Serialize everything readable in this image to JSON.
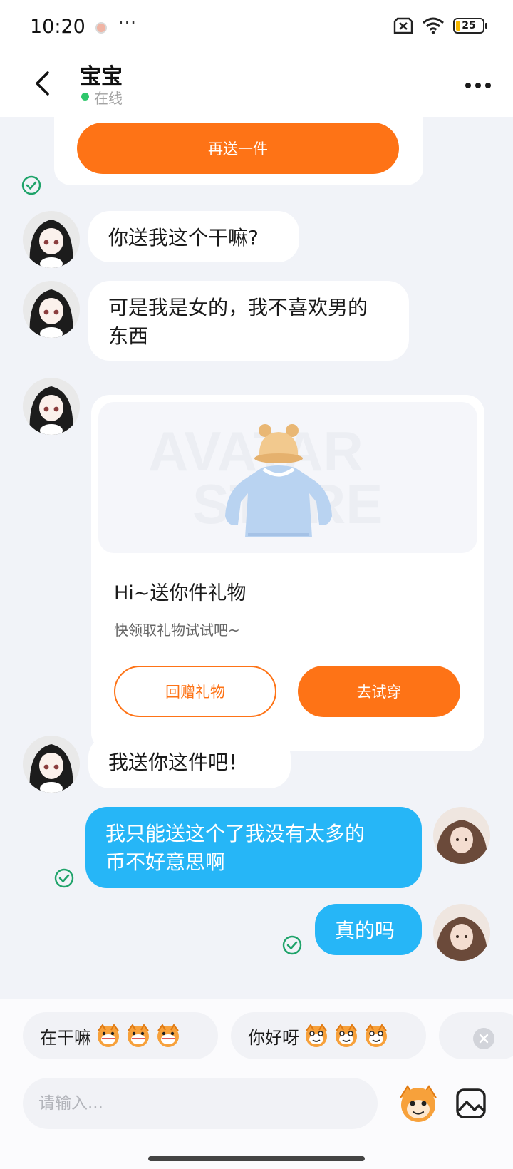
{
  "status_bar": {
    "time": "10:20",
    "more": "···",
    "battery": "25"
  },
  "header": {
    "contact_name": "宝宝",
    "online_status": "在线"
  },
  "top_card": {
    "resend_label": "再送一件"
  },
  "messages": [
    {
      "sender": "them",
      "text": "你送我这个干嘛?"
    },
    {
      "sender": "them",
      "text_line1": "可是我是女的，我不喜欢男的",
      "text_line2": "东西"
    },
    {
      "sender": "them",
      "type": "gift"
    },
    {
      "sender": "them",
      "text": "我送你这件吧！"
    },
    {
      "sender": "me",
      "text_line1": "我只能送这个了我没有太多的",
      "text_line2": "币不好意思啊"
    },
    {
      "sender": "me",
      "text": "真的吗"
    }
  ],
  "gift_card": {
    "title": "Hi~送你件礼物",
    "subtitle": "快领取礼物试试吧~",
    "return_label": "回赠礼物",
    "try_label": "去试穿",
    "watermark_line1": "AVATAR",
    "watermark_line2": "STORE"
  },
  "quick_replies": [
    {
      "text": "在干嘛",
      "emoji": "grin-monkey-icon"
    },
    {
      "text": "你好呀",
      "emoji": "smile-monkey-icon"
    }
  ],
  "input": {
    "placeholder": "请输入..."
  },
  "colors": {
    "accent": "#fe7316",
    "self_bubble": "#26b6f7",
    "online": "#2ec76b",
    "check": "#1fa36a"
  }
}
